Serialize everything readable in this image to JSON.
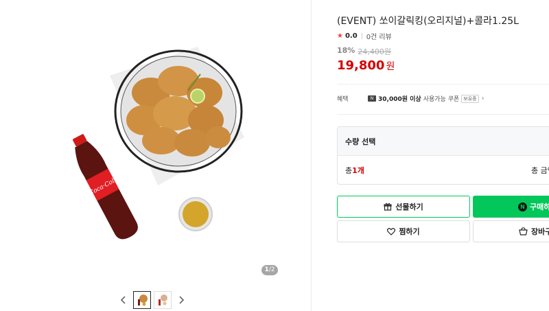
{
  "gallery": {
    "page_current": "1",
    "page_total": "/2",
    "prev_icon": "chevron-left-icon",
    "next_icon": "chevron-right-icon"
  },
  "product": {
    "title": "(EVENT) 쏘이갈릭킹(오리지널)+콜라1.25L",
    "rating": "0.0",
    "reviews": "0건 리뷰",
    "discount_rate": "18%",
    "original_price": "24,400원",
    "price": "19,800",
    "price_unit": "원",
    "accent_color": "#d60000"
  },
  "benefit": {
    "label": "혜택",
    "coupon_amount": "30,000원 이상",
    "coupon_text": "사용가능 쿠폰",
    "badge": "보유중"
  },
  "quantity": {
    "header": "수량 선택",
    "total_prefix": "총 ",
    "count": "1개",
    "total_amount_label": "총 금액"
  },
  "buttons": {
    "gift": "선물하기",
    "buy": "구매하기",
    "wish": "찜하기",
    "cart": "장바구니",
    "npay_mark": "N",
    "buy_color": "#03c75a"
  }
}
